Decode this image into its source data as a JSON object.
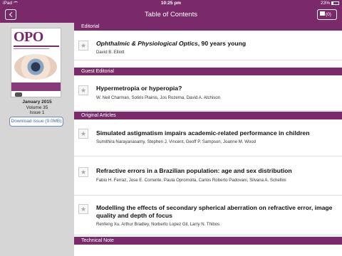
{
  "status_bar": {
    "carrier": "iPad",
    "time": "10:25 pm",
    "battery": "23%"
  },
  "nav": {
    "title": "Table of Contents",
    "download_count": "(0)"
  },
  "issue": {
    "cover_title": "OPO",
    "date": "January 2015",
    "volume": "Volume 35",
    "issue": "Issue 1",
    "download_label": "Download issue (9.0MB)"
  },
  "sections": [
    {
      "name": "Editorial",
      "articles": [
        {
          "title_italic": "Ophthalmic & Physiological Optics",
          "title_rest": ", 90 years young",
          "authors": "David B. Elliott"
        }
      ]
    },
    {
      "name": "Guest Editorial",
      "articles": [
        {
          "title": "Hypermetropia or hyperopia?",
          "authors": "W. Neil Charman, Sotiris Plainis, Jos Rozema, David A. Atchison"
        }
      ]
    },
    {
      "name": "Original Articles",
      "articles": [
        {
          "title": "Simulated astigmatism impairs academic-related performance in children",
          "authors": "Sumithira Narayanasamy, Stephen J. Vincent, Geoff P. Sampson, Joanne M. Wood"
        },
        {
          "title": "Refractive errors in a Brazilian population: age and sex distribution",
          "authors": "Fabio H. Ferraz, Jose E. Corrente, Paula Opromolla, Carlos Roberto Padovani, Silvana A. Schellini"
        },
        {
          "title": "Modelling the effects of secondary spherical aberration on refractive error, image quality and depth of focus",
          "authors": "Renfeng Xu, Arthur Bradley, Norberto Lopez Gil, Larry N. Thibos"
        }
      ]
    },
    {
      "name": "Technical Note",
      "articles": []
    }
  ],
  "star_glyph": "★"
}
